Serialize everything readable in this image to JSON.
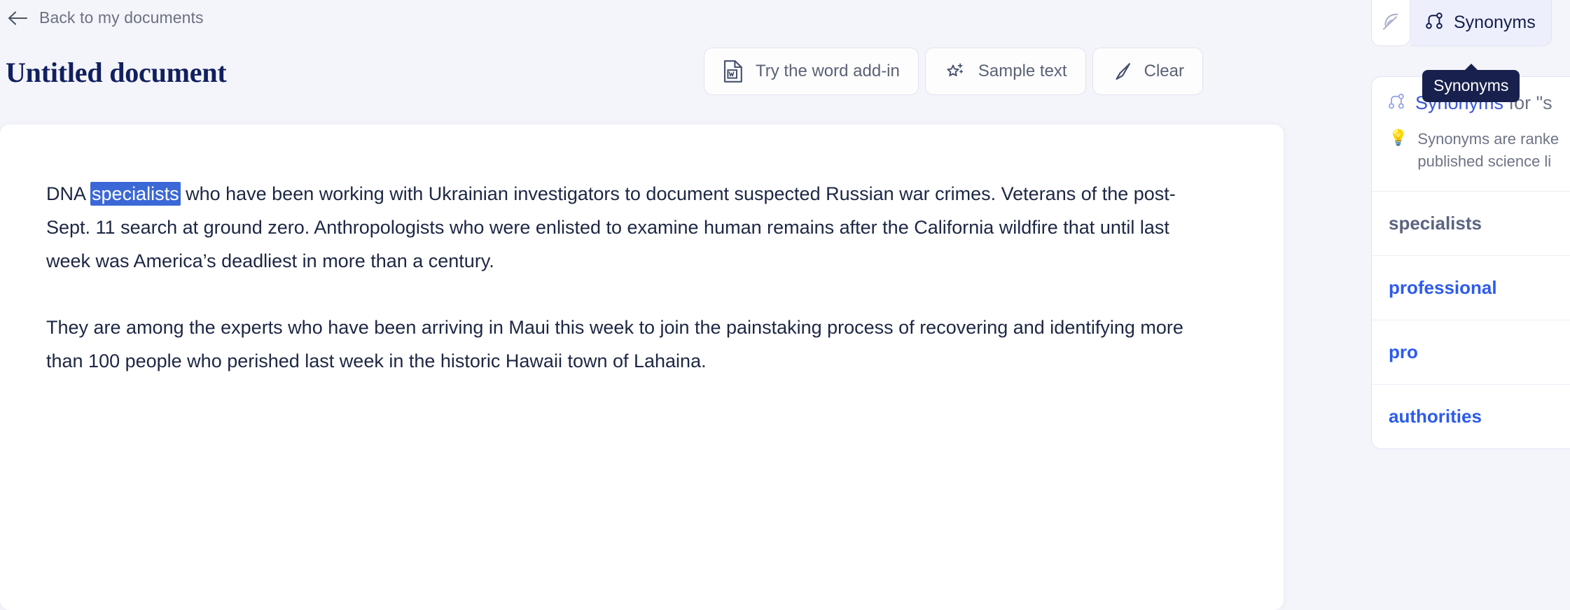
{
  "nav": {
    "back_label": "Back to my documents",
    "back_icon": "arrow-left-icon"
  },
  "document": {
    "title": "Untitled document",
    "paragraphs": [
      {
        "before": "DNA ",
        "selected": "specialists",
        "after": " who have been working with Ukrainian investigators to document suspected Russian war crimes. Veterans of the post-Sept. 11 search at ground zero. Anthropologists who were enlisted to examine human remains after the California wildfire that until last week was America’s deadliest in more than a century."
      },
      {
        "text": "They are among the experts who have been arriving in Maui this week to join the painstaking process of recovering and identifying more than 100 people who perished last week in the historic Hawaii town of Lahaina."
      }
    ]
  },
  "toolbar": {
    "buttons": [
      {
        "label": "Try the word add-in",
        "icon": "word-document-icon"
      },
      {
        "label": "Sample text",
        "icon": "sparkle-star-icon"
      },
      {
        "label": "Clear",
        "icon": "eraser-wand-icon"
      }
    ]
  },
  "panel": {
    "tabs": [
      {
        "label": "",
        "icon": "feather-icon",
        "active": false
      },
      {
        "label": "Synonyms",
        "icon": "synonyms-branch-icon",
        "active": true
      }
    ],
    "tooltip": "Synonyms",
    "header": {
      "icon": "synonyms-branch-icon",
      "keyword": "Synonyms",
      "for": " for ",
      "quote": "\"s"
    },
    "hint": {
      "icon": "lightbulb-icon",
      "line1": "Synonyms are ranke",
      "line2": "published science li"
    },
    "source_word": "specialists",
    "synonyms": [
      "professional",
      "pro",
      "authorities"
    ]
  },
  "colors": {
    "page_bg": "#f4f4fb",
    "accent_blue": "#2d5bec",
    "selection_blue": "#3b68d6",
    "title_navy": "#11205e",
    "tooltip_bg": "#18214d"
  }
}
